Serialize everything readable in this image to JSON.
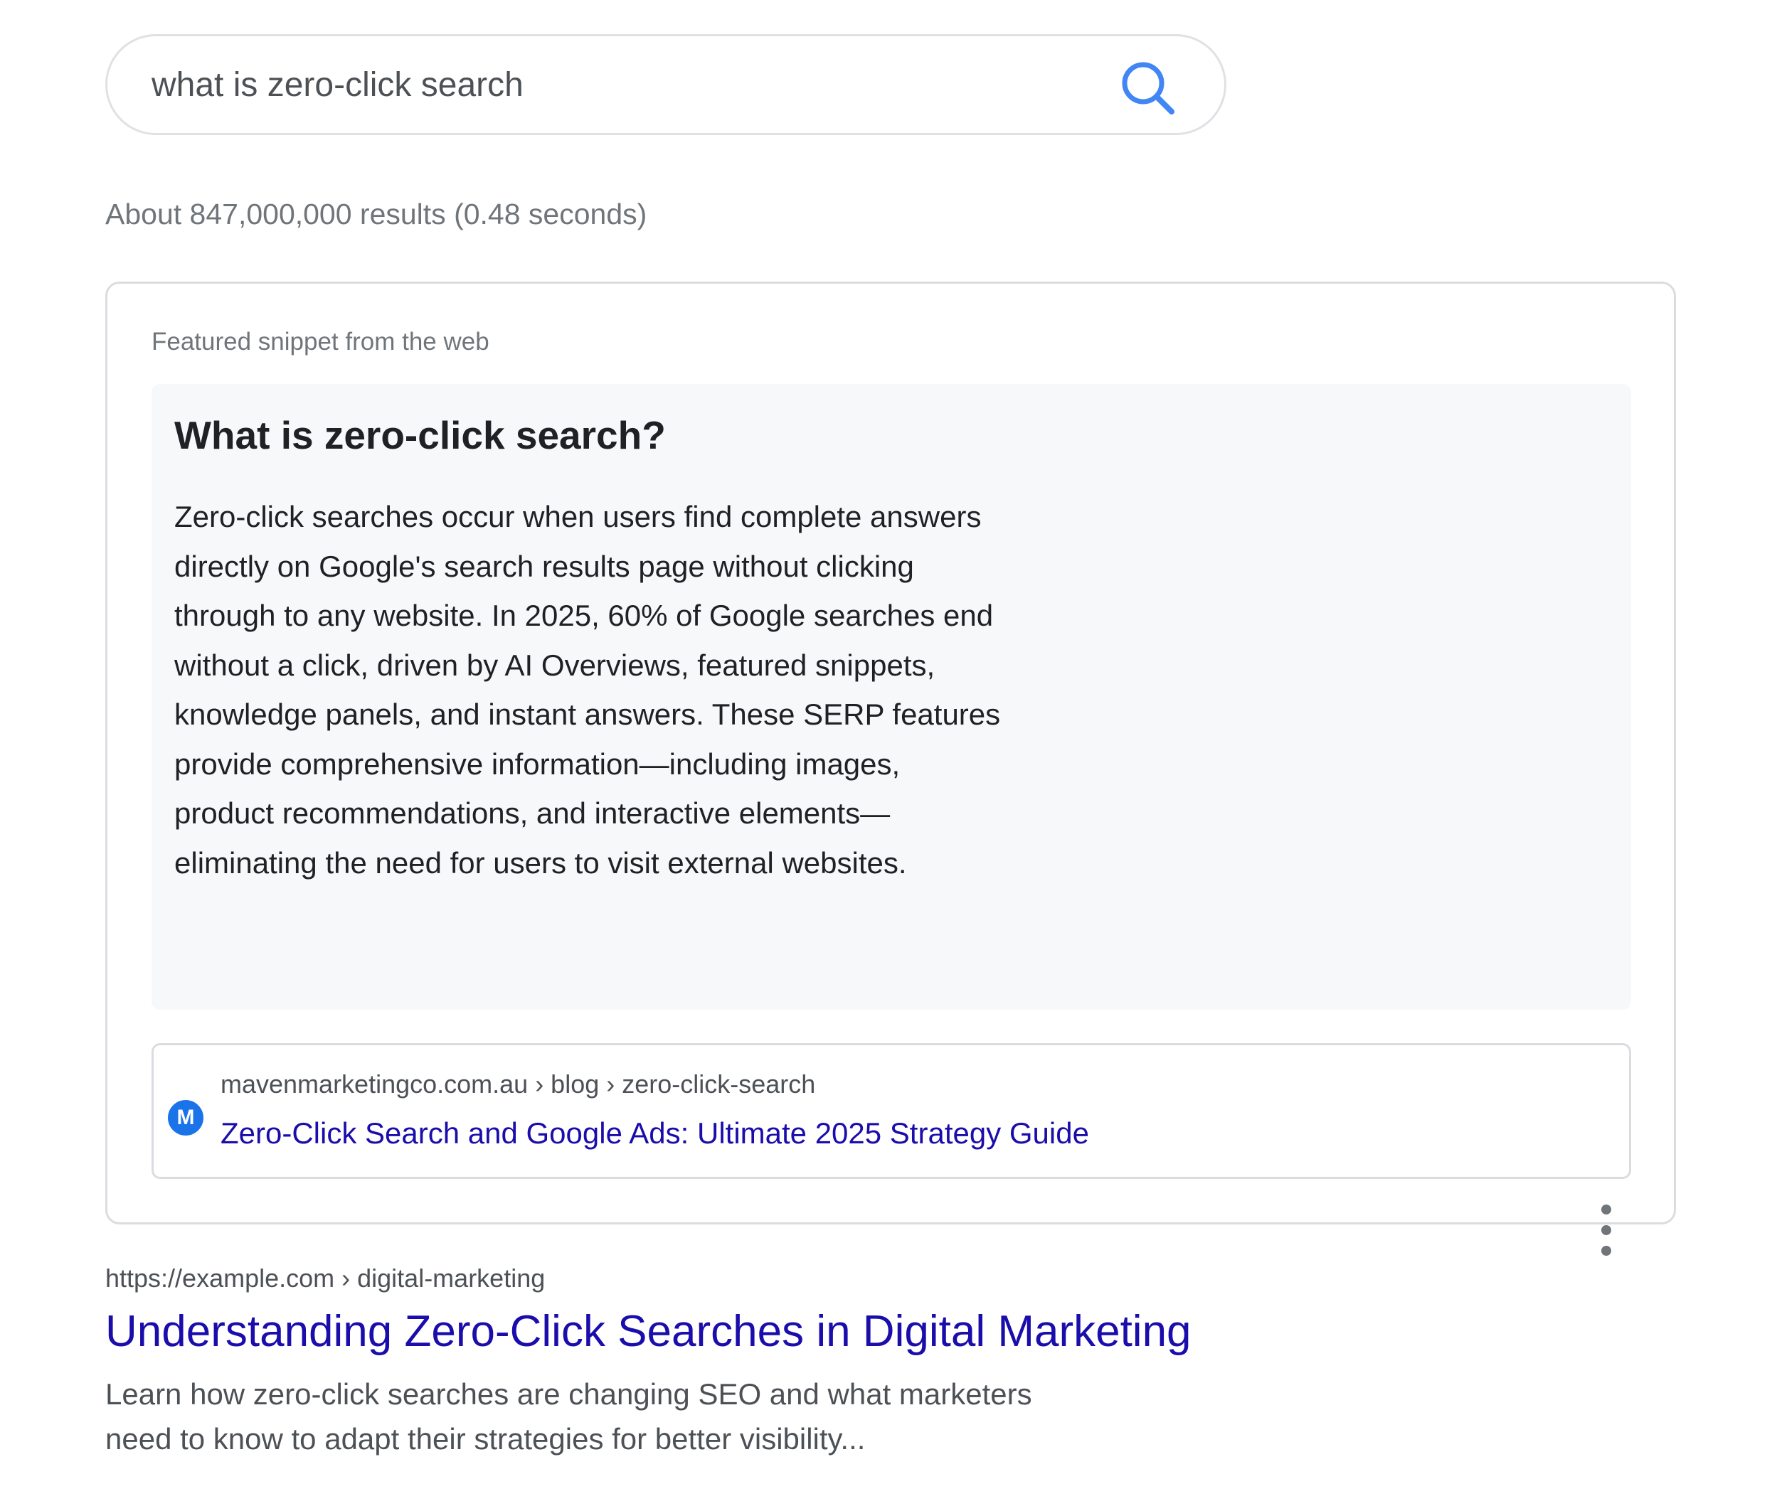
{
  "search": {
    "query": "what is zero-click search"
  },
  "result_stats": "About 847,000,000 results (0.48 seconds)",
  "featured_snippet": {
    "label": "Featured snippet from the web",
    "question": "What is zero-click search?",
    "answer": "Zero-click searches occur when users find complete answers directly on Google's search results page without clicking through to any website. In 2025, 60% of Google searches end without a click, driven by AI Overviews, featured snippets, knowledge panels, and instant answers. These SERP features provide comprehensive information—including images, product recommendations, and interactive elements—eliminating the need for users to visit external websites.",
    "source": {
      "favicon_letter": "M",
      "url": "mavenmarketingco.com.au › blog › zero-click-search",
      "title": "Zero-Click Search and Google Ads: Ultimate 2025 Strategy Guide"
    }
  },
  "results": [
    {
      "url": "https://example.com › digital-marketing",
      "title": "Understanding Zero-Click Searches in Digital Marketing",
      "description": "Learn how zero-click searches are changing SEO and what marketers need to know to adapt their strategies for better visibility..."
    }
  ],
  "colors": {
    "link": "#1a0dab",
    "accent": "#1a73e8",
    "search_icon": "#4285f4",
    "muted": "#70757a",
    "snippet_bg": "#f7f8fa"
  },
  "icons": {
    "search": "search-icon",
    "more": "more-vertical-icon"
  }
}
